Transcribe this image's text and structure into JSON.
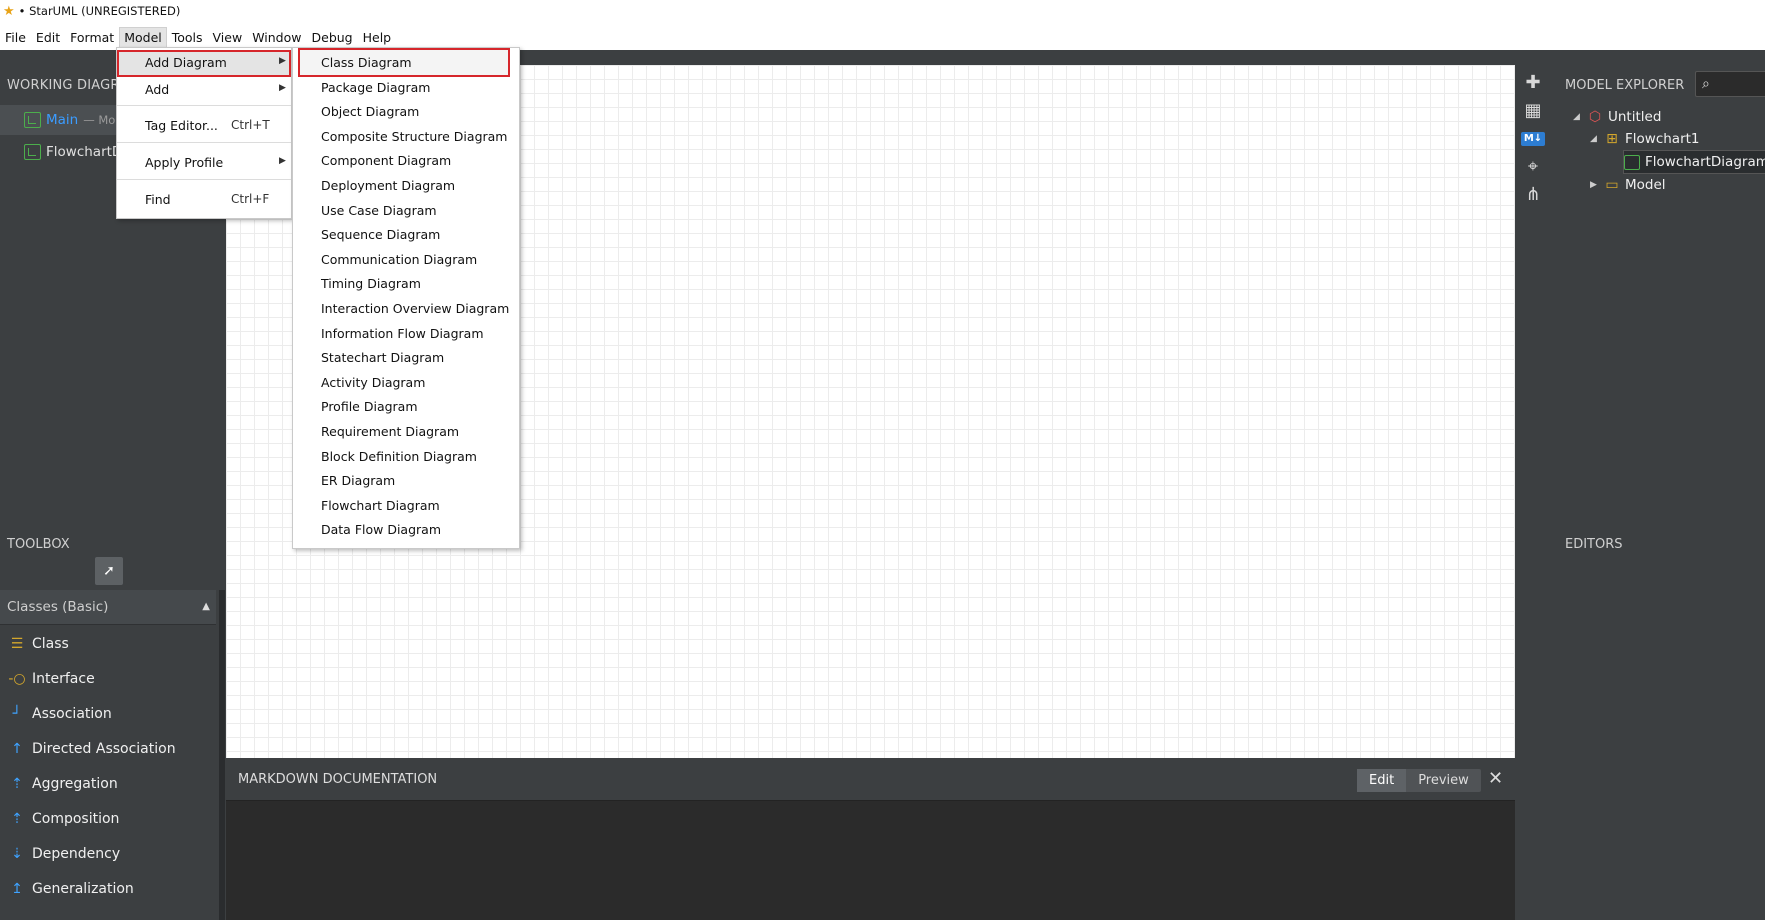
{
  "window": {
    "title": "• StarUML (UNREGISTERED)"
  },
  "menubar": [
    "File",
    "Edit",
    "Format",
    "Model",
    "Tools",
    "View",
    "Window",
    "Debug",
    "Help"
  ],
  "working_diagrams": {
    "header": "WORKING DIAGRA",
    "items": [
      {
        "label": "Main",
        "sub": "— Mod"
      },
      {
        "label": "FlowchartD"
      }
    ]
  },
  "toolbox": {
    "header": "TOOLBOX",
    "group": "Classes (Basic)",
    "items": [
      "Class",
      "Interface",
      "Association",
      "Directed Association",
      "Aggregation",
      "Composition",
      "Dependency",
      "Generalization"
    ]
  },
  "model_menu": {
    "items": [
      {
        "label": "Add Diagram",
        "submenu": true
      },
      {
        "label": "Add",
        "submenu": true
      },
      {
        "label": "Tag Editor...",
        "shortcut": "Ctrl+T"
      },
      {
        "label": "Apply Profile",
        "submenu": true
      },
      {
        "label": "Find",
        "shortcut": "Ctrl+F"
      }
    ]
  },
  "diagram_menu": {
    "items": [
      "Class Diagram",
      "Package Diagram",
      "Object Diagram",
      "Composite Structure Diagram",
      "Component Diagram",
      "Deployment Diagram",
      "Use Case Diagram",
      "Sequence Diagram",
      "Communication Diagram",
      "Timing Diagram",
      "Interaction Overview Diagram",
      "Information Flow Diagram",
      "Statechart Diagram",
      "Activity Diagram",
      "Profile Diagram",
      "Requirement Diagram",
      "Block Definition Diagram",
      "ER Diagram",
      "Flowchart Diagram",
      "Data Flow Diagram"
    ]
  },
  "markdown": {
    "title": "MARKDOWN DOCUMENTATION",
    "tabs": [
      "Edit",
      "Preview"
    ],
    "close": "✕"
  },
  "model_explorer": {
    "header": "MODEL EXPLORER",
    "tree": [
      "Untitled",
      "Flowchart1",
      "FlowchartDiagram",
      "Model"
    ]
  },
  "editors": {
    "header": "EDITORS"
  }
}
